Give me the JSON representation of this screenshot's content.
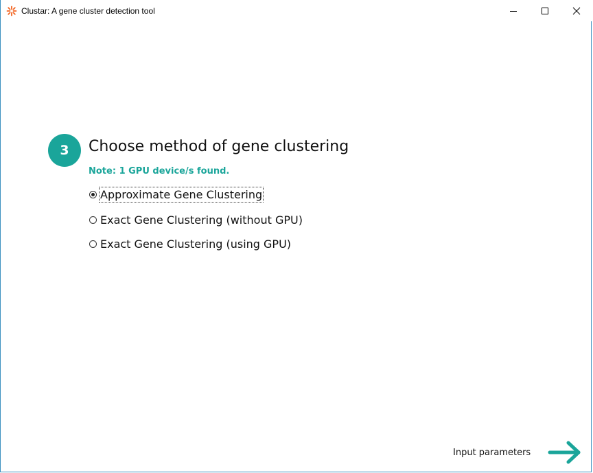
{
  "window": {
    "title": "Clustar: A gene cluster detection tool",
    "app_icon": "clustar-asterisk-icon",
    "controls": [
      "minimize-icon",
      "maximize-icon",
      "close-icon"
    ]
  },
  "step": {
    "number": "3",
    "heading": "Choose method of gene clustering",
    "note": "Note: 1 GPU device/s found."
  },
  "options": [
    {
      "label": "Approximate Gene Clustering",
      "selected": true
    },
    {
      "label": "Exact Gene Clustering (without GPU)",
      "selected": false
    },
    {
      "label": "Exact Gene Clustering (using GPU)",
      "selected": false
    }
  ],
  "footer": {
    "next_label": "Input parameters",
    "next_icon": "arrow-right-icon"
  },
  "colors": {
    "accent": "#1aa59a",
    "app_icon": "#f26522",
    "window_border": "#3a8fbf"
  }
}
